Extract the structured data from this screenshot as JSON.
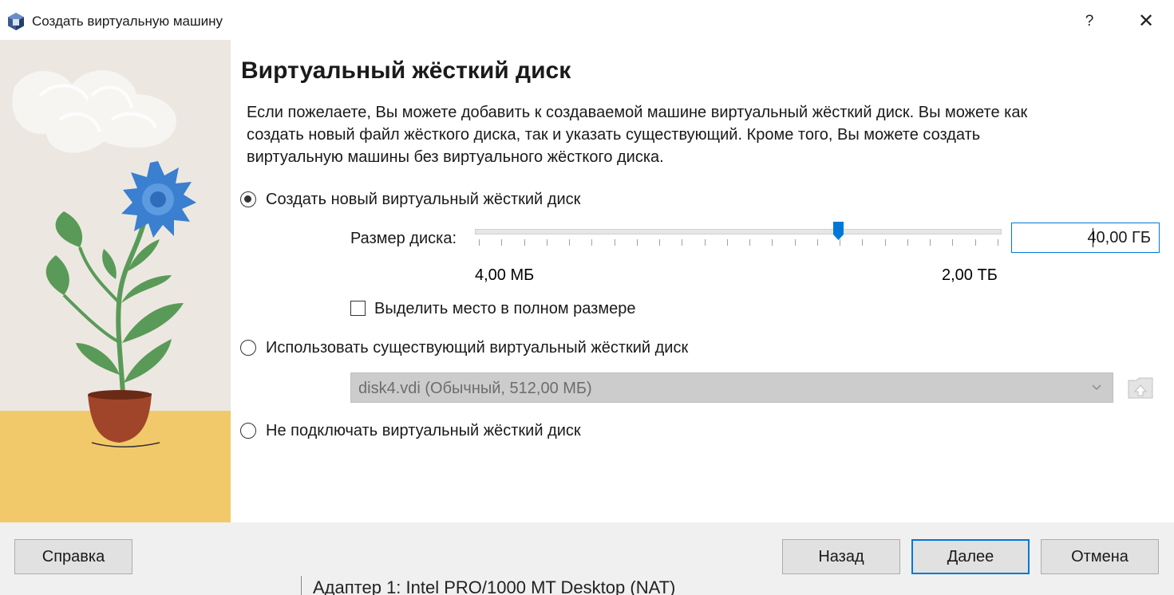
{
  "window": {
    "title": "Создать виртуальную машину",
    "help_label": "?",
    "close_label": "✕"
  },
  "page": {
    "title": "Виртуальный жёсткий диск",
    "description": "Если пожелаете, Вы можете добавить к создаваемой машине виртуальный жёсткий диск. Вы можете как создать новый файл жёсткого диска, так и указать существующий. Кроме того, Вы можете создать виртуальную машины без виртуального жёсткого диска."
  },
  "options": {
    "create_new": {
      "label": "Создать новый виртуальный жёсткий диск",
      "selected": true
    },
    "use_existing": {
      "label": "Использовать существующий виртуальный жёсткий диск",
      "selected": false
    },
    "no_disk": {
      "label": "Не подключать виртуальный жёсткий диск",
      "selected": false
    }
  },
  "disk_size": {
    "label": "Размер диска:",
    "value": "40,00 ГБ",
    "min_label": "4,00 МБ",
    "max_label": "2,00 ТБ",
    "slider_fraction": 0.69,
    "tick_count": 24
  },
  "preallocate": {
    "label": "Выделить место в полном размере",
    "checked": false
  },
  "existing_disk": {
    "selected": "disk4.vdi (Обычный, 512,00 МБ)",
    "enabled": false
  },
  "buttons": {
    "help": "Справка",
    "back": "Назад",
    "next": "Далее",
    "cancel": "Отмена"
  },
  "background": {
    "partial_text": "Адаптер 1:   Intel PRO/1000 MT Desktop (NAT)"
  },
  "colors": {
    "accent": "#0078d7",
    "flower": "#3a7fd0",
    "leaf": "#5a9a58",
    "pot": "#a0452a",
    "floor": "#f2c96a"
  }
}
